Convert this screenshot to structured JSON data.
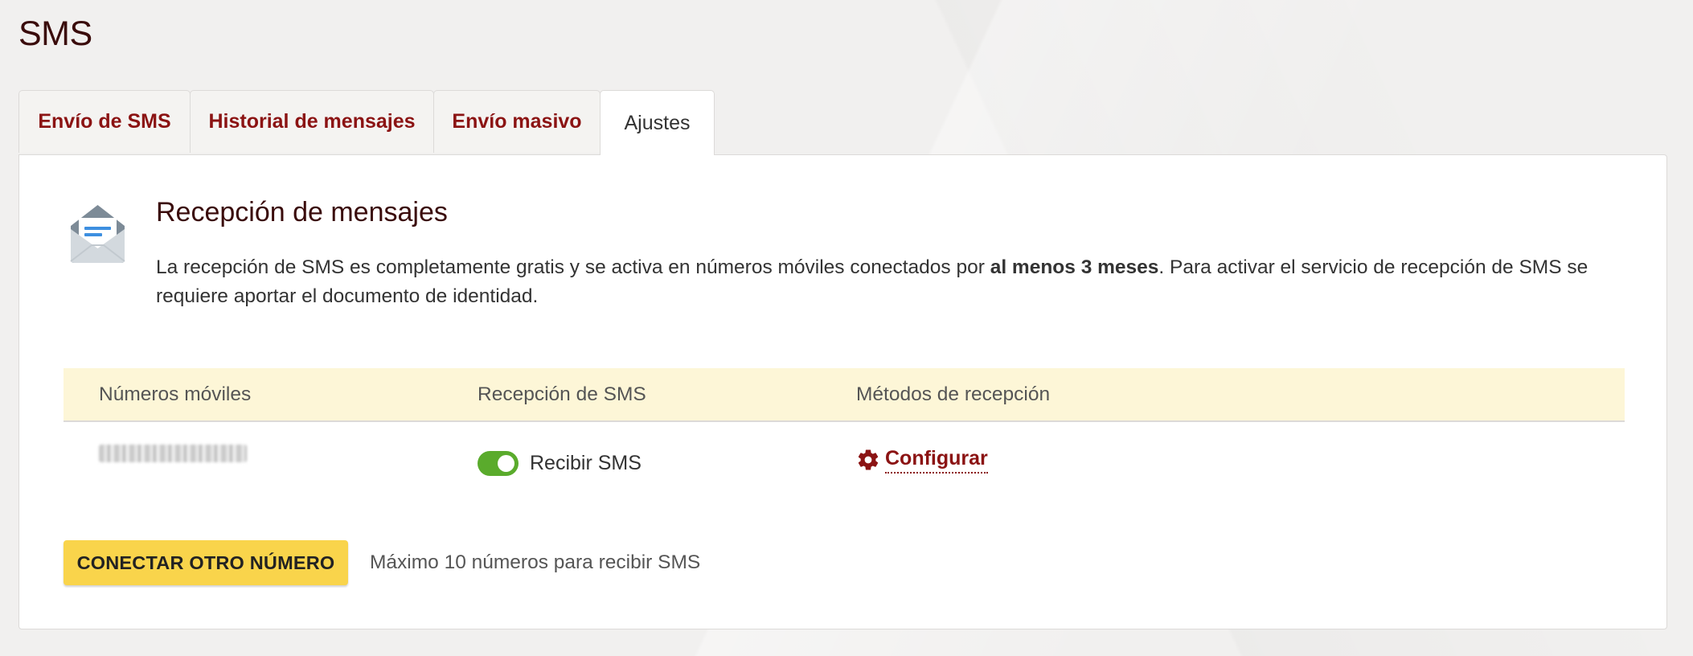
{
  "page": {
    "title": "SMS"
  },
  "tabs": [
    {
      "label": "Envío de SMS",
      "active": false
    },
    {
      "label": "Historial de mensajes",
      "active": false
    },
    {
      "label": "Envío masivo",
      "active": false
    },
    {
      "label": "Ajustes",
      "active": true
    }
  ],
  "section": {
    "icon": "envelope-open-icon",
    "title": "Recepción de mensajes",
    "description_part1": "La recepción de SMS es completamente gratis y se activa en números móviles conectados por ",
    "description_bold": "al menos 3 meses",
    "description_part2": ". Para activar el servicio de recepción de SMS se requiere aportar el documento de identidad."
  },
  "table": {
    "headers": [
      "Números móviles",
      "Recepción de SMS",
      "Métodos de recepción"
    ],
    "rows": [
      {
        "toggle_on": true,
        "toggle_label": "Recibir SMS",
        "method_icon": "gear-icon",
        "method_label": "Configurar"
      }
    ]
  },
  "footer": {
    "connect_button_label": "CONECTAR OTRO NÚMERO",
    "max_note": "Máximo 10 números para recibir SMS"
  },
  "colors": {
    "brand_red": "#8b1313",
    "title_dark": "#3a0b0b",
    "button_yellow": "#f9d44b",
    "header_yellow": "#fdf6d7",
    "toggle_green": "#5aab2c"
  }
}
